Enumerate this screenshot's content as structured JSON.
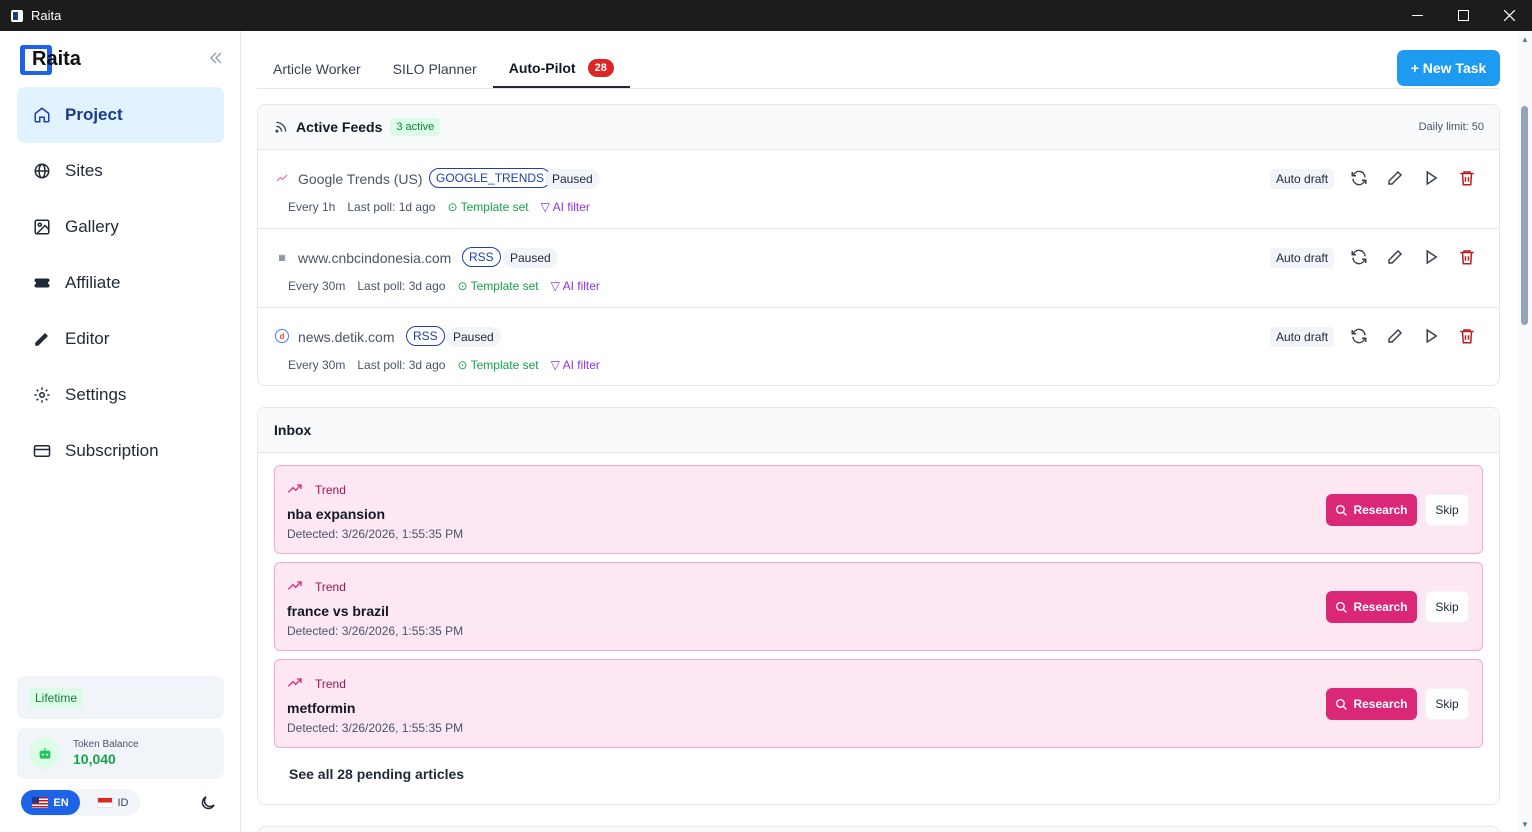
{
  "window": {
    "title": "Raita"
  },
  "sidebar": {
    "brand": "Raita",
    "items": [
      {
        "label": "Project",
        "icon": "home-icon",
        "active": true
      },
      {
        "label": "Sites",
        "icon": "globe-icon"
      },
      {
        "label": "Gallery",
        "icon": "image-icon"
      },
      {
        "label": "Affiliate",
        "icon": "ticket-icon"
      },
      {
        "label": "Editor",
        "icon": "pencil-icon"
      },
      {
        "label": "Settings",
        "icon": "gear-icon"
      },
      {
        "label": "Subscription",
        "icon": "credit-card-icon"
      }
    ],
    "plan_badge": "Lifetime",
    "token_label": "Token Balance",
    "token_value": "10,040",
    "lang_en": "EN",
    "lang_id": "ID"
  },
  "tabs": [
    {
      "label": "Article Worker"
    },
    {
      "label": "SILO Planner"
    },
    {
      "label": "Auto-Pilot",
      "badge": "28",
      "active": true
    }
  ],
  "new_task_label": "+ New Task",
  "feeds": {
    "title": "Active Feeds",
    "active_badge": "3 active",
    "daily_limit": "Daily limit: 50",
    "rows": [
      {
        "name": "Google Trends (US)",
        "type": "GOOGLE_TRENDS",
        "status": "Paused",
        "interval": "Every 1h",
        "last_poll": "Last poll: 1d ago",
        "template": "Template set",
        "ai_filter": "AI filter",
        "mode": "Auto draft"
      },
      {
        "name": "www.cnbcindonesia.com",
        "type": "RSS",
        "status": "Paused",
        "interval": "Every 30m",
        "last_poll": "Last poll: 3d ago",
        "template": "Template set",
        "ai_filter": "AI filter",
        "mode": "Auto draft"
      },
      {
        "name": "news.detik.com",
        "type": "RSS",
        "status": "Paused",
        "interval": "Every 30m",
        "last_poll": "Last poll: 3d ago",
        "template": "Template set",
        "ai_filter": "AI filter",
        "mode": "Auto draft"
      }
    ]
  },
  "inbox": {
    "title": "Inbox",
    "items": [
      {
        "tag": "Trend",
        "title": "nba expansion",
        "detected": "Detected: 3/26/2026, 1:55:35 PM"
      },
      {
        "tag": "Trend",
        "title": "france vs brazil",
        "detected": "Detected: 3/26/2026, 1:55:35 PM"
      },
      {
        "tag": "Trend",
        "title": "metformin",
        "detected": "Detected: 3/26/2026, 1:55:35 PM"
      }
    ],
    "research_label": "Research",
    "skip_label": "Skip",
    "see_all": "See all 28 pending articles"
  },
  "colors": {
    "accent": "#1e9bf0",
    "active_nav_bg": "#e0f2fe",
    "trend_card_bg": "#fce7f3",
    "research_button": "#db2777",
    "badge_red": "#dc2626",
    "success_green": "#16a34a",
    "ai_purple": "#9333ea"
  }
}
